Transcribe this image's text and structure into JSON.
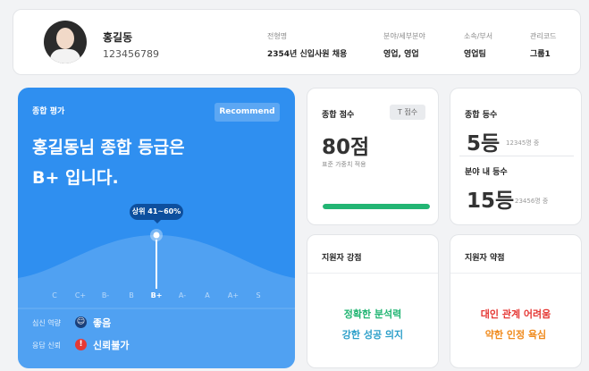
{
  "profile": {
    "name": "홍길동",
    "id": "123456789",
    "meta": [
      {
        "label": "전형명",
        "value": "2354년 신입사원 채용"
      },
      {
        "label": "분야/세부분야",
        "value": "영업, 영업"
      },
      {
        "label": "소속/부서",
        "value": "영업팀"
      },
      {
        "label": "관리코드",
        "value": "그룹1"
      }
    ]
  },
  "summary": {
    "label": "종합 평가",
    "recommend_button": "Recommend",
    "headline_line1": "홍길동님 종합 등급은",
    "headline_line2": "B+ 입니다.",
    "percentile_badge": "상위 41~60%",
    "grades": [
      "C",
      "C+",
      "B-",
      "B",
      "B+",
      "A-",
      "A",
      "A+",
      "S"
    ],
    "active_grade": "B+",
    "mental_label": "심신 역량",
    "mental_value": "좋음",
    "response_label": "응답 신뢰",
    "response_value": "신뢰불가",
    "colors": {
      "card": "#2f8ff0",
      "good_icon": "#1a3f7a",
      "bad_icon": "#e53935"
    }
  },
  "score": {
    "title": "종합 점수",
    "t_button": "T 점수",
    "value": "80점",
    "note": "표준 가중치 적용",
    "progress": 1.0,
    "progress_color": "#22b573"
  },
  "rank": {
    "title": "종합 등수",
    "value": "5등",
    "total": "12345명 중",
    "field_title": "분야 내 등수",
    "field_value": "15등",
    "field_total": "23456명 중"
  },
  "strengths": {
    "title": "지원자 강점",
    "items": [
      "정확한 분석력",
      "강한 성공 의지"
    ],
    "colors": [
      "#22b573",
      "#2c9fc9"
    ]
  },
  "weaknesses": {
    "title": "지원자 약점",
    "items": [
      "대인 관계 어려움",
      "약한 인정 욕심"
    ],
    "colors": [
      "#e53935",
      "#f08a1c"
    ]
  }
}
